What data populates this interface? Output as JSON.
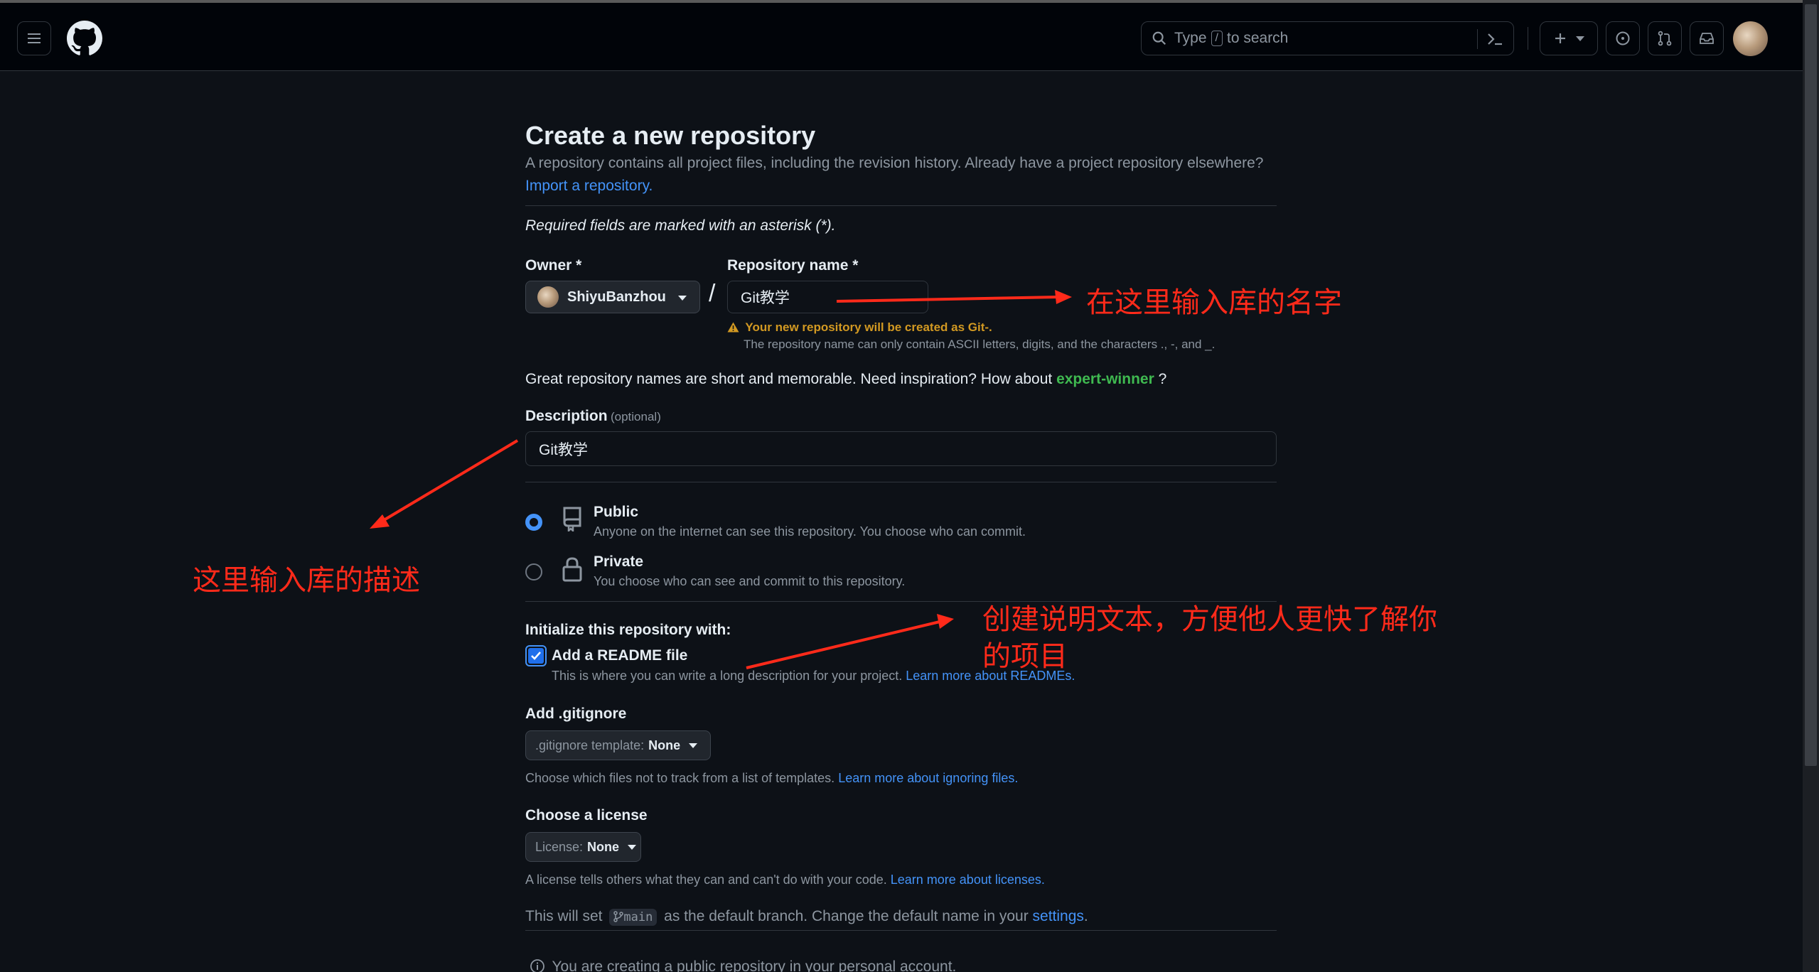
{
  "header": {
    "search_prefix": "Type",
    "search_key": "/",
    "search_suffix": "to search"
  },
  "page": {
    "title": "Create a new repository",
    "subtitle": "A repository contains all project files, including the revision history. Already have a project repository elsewhere?",
    "import_link": "Import a repository.",
    "required_note": "Required fields are marked with an asterisk (*)."
  },
  "owner": {
    "label": "Owner *",
    "value": "ShiyuBanzhou",
    "separator": "/"
  },
  "repo_name": {
    "label": "Repository name *",
    "value": "Git教学",
    "warning": "Your new repository will be created as Git-.",
    "hint": "The repository name can only contain ASCII letters, digits, and the characters .,  -, and _."
  },
  "inspiration": {
    "text": "Great repository names are short and memorable. Need inspiration? How about",
    "suggestion": "expert-winner",
    "end": "?"
  },
  "description": {
    "label": "Description",
    "optional": "(optional)",
    "value": "Git教学"
  },
  "visibility": {
    "public_label": "Public",
    "public_desc": "Anyone on the internet can see this repository. You choose who can commit.",
    "private_label": "Private",
    "private_desc": "You choose who can see and commit to this repository.",
    "selected": "public"
  },
  "init": {
    "heading": "Initialize this repository with:",
    "readme_label": "Add a README file",
    "readme_desc": "This is where you can write a long description for your project.",
    "readme_link": "Learn more about READMEs.",
    "readme_checked": true
  },
  "gitignore": {
    "heading": "Add .gitignore",
    "button_prefix": ".gitignore template:",
    "button_value": "None",
    "desc": "Choose which files not to track from a list of templates.",
    "link": "Learn more about ignoring files."
  },
  "license": {
    "heading": "Choose a license",
    "button_prefix": "License:",
    "button_value": "None",
    "desc": "A license tells others what they can and can't do with your code.",
    "link": "Learn more about licenses."
  },
  "branch": {
    "prefix": "This will set",
    "branch_name": "main",
    "middle": "as the default branch. Change the default name in your",
    "link": "settings",
    "end": "."
  },
  "footer_note": "You are creating a public repository in your personal account.",
  "annotations": {
    "name_note": "在这里输入库的名字",
    "desc_note": "这里输入库的描述",
    "readme_note_line1": "创建说明文本，方便他人更快了解你",
    "readme_note_line2": "的项目"
  },
  "colors": {
    "background": "#0d1117",
    "header": "#010409",
    "link": "#4493f8",
    "suggestion": "#3fb950",
    "warning": "#d29922",
    "annotation": "#ff2a1a"
  }
}
